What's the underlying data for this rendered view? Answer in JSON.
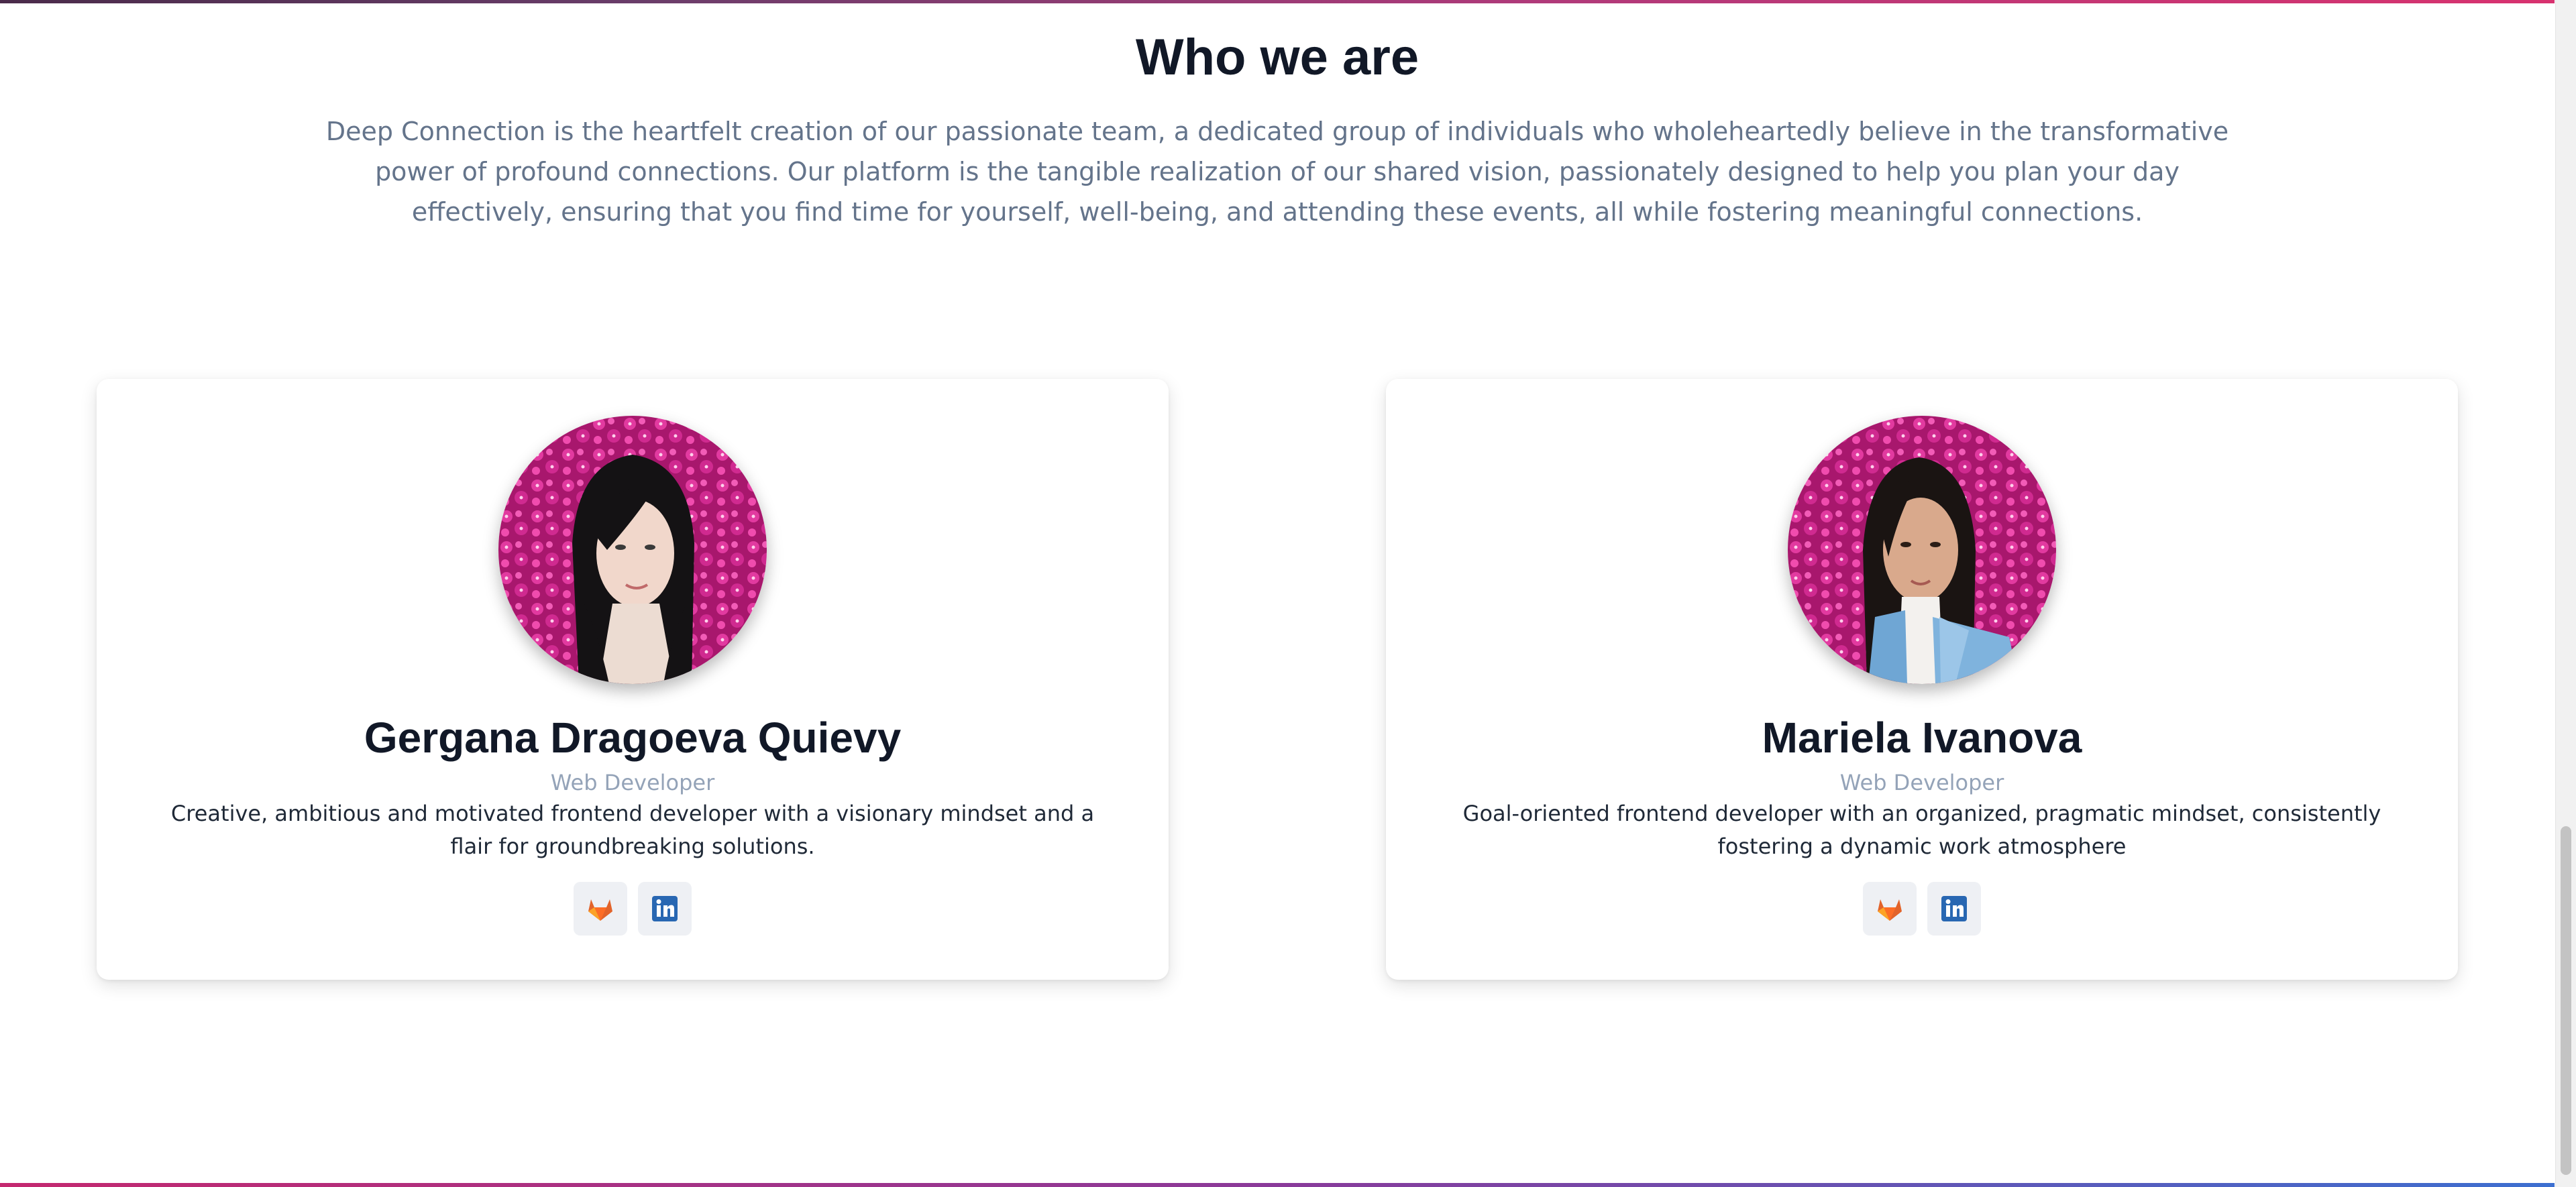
{
  "section": {
    "title": "Who we are",
    "intro": "Deep Connection is the heartfelt creation of our passionate team, a dedicated group of individuals who wholeheartedly believe in the transformative power of profound connections. Our platform is the tangible realization of our shared vision, passionately designed to help you plan your day effectively, ensuring that you find time for yourself, well-being, and attending these events, all while fostering meaningful connections."
  },
  "team": [
    {
      "name": "Gergana Dragoeva Quievy",
      "role": "Web Developer",
      "bio": "Creative, ambitious and motivated frontend developer with a visionary mindset and a flair for groundbreaking solutions.",
      "socials": [
        {
          "icon": "gitlab-icon"
        },
        {
          "icon": "linkedin-icon"
        }
      ]
    },
    {
      "name": "Mariela Ivanova",
      "role": "Web Developer",
      "bio": "Goal-oriented frontend developer with an organized, pragmatic mindset, consistently fostering a dynamic work atmosphere",
      "socials": [
        {
          "icon": "gitlab-icon"
        },
        {
          "icon": "linkedin-icon"
        }
      ]
    }
  ],
  "colors": {
    "heading": "#111827",
    "intro_text": "#64748b",
    "role_text": "#94a3b8",
    "gitlab_orange": "#e2632a",
    "linkedin_blue": "#2867b2",
    "flower_magenta": "#d02a90",
    "accent_gradient_start": "#c4286f",
    "accent_gradient_end": "#3c6fd0"
  }
}
